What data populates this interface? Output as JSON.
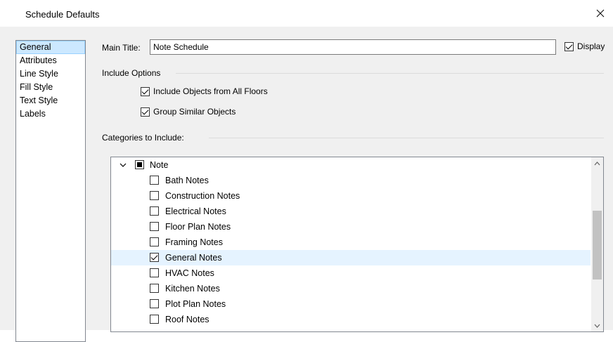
{
  "window": {
    "title": "Schedule Defaults",
    "close_label": "×"
  },
  "sidebar": {
    "items": [
      {
        "label": "General",
        "selected": true
      },
      {
        "label": "Attributes",
        "selected": false
      },
      {
        "label": "Line Style",
        "selected": false
      },
      {
        "label": "Fill Style",
        "selected": false
      },
      {
        "label": "Text Style",
        "selected": false
      },
      {
        "label": "Labels",
        "selected": false
      }
    ]
  },
  "main": {
    "main_title_label": "Main Title:",
    "main_title_value": "Note Schedule",
    "display_label": "Display",
    "display_checked": true,
    "include_options_heading": "Include Options",
    "include_all_floors_label": "Include Objects from All Floors",
    "include_all_floors_checked": true,
    "group_similar_label": "Group Similar Objects",
    "group_similar_checked": true,
    "categories_heading": "Categories to Include:"
  },
  "tree": {
    "root": {
      "label": "Note",
      "state": "indeterminate",
      "expanded": true
    },
    "items": [
      {
        "label": "Bath Notes",
        "checked": false,
        "selected": false
      },
      {
        "label": "Construction Notes",
        "checked": false,
        "selected": false
      },
      {
        "label": "Electrical Notes",
        "checked": false,
        "selected": false
      },
      {
        "label": "Floor Plan Notes",
        "checked": false,
        "selected": false
      },
      {
        "label": "Framing Notes",
        "checked": false,
        "selected": false
      },
      {
        "label": "General Notes",
        "checked": true,
        "selected": true
      },
      {
        "label": "HVAC Notes",
        "checked": false,
        "selected": false
      },
      {
        "label": "Kitchen Notes",
        "checked": false,
        "selected": false
      },
      {
        "label": "Plot Plan Notes",
        "checked": false,
        "selected": false
      },
      {
        "label": "Roof Notes",
        "checked": false,
        "selected": false
      }
    ]
  },
  "colors": {
    "selection_fill": "#cce8ff",
    "tree_selection_fill": "#e5f3ff",
    "dialog_bg": "#f0f0f0"
  }
}
